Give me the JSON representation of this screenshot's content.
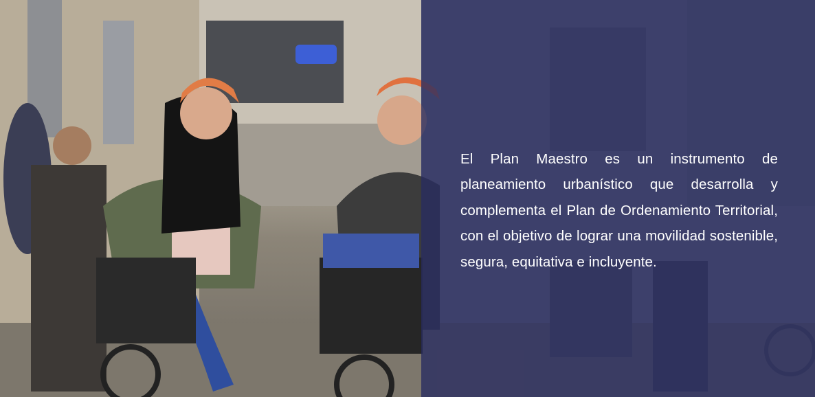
{
  "hero": {
    "image_alt": "Mujeres en bicicleta con cascos y canastas en una calle de la ciudad",
    "description": "El Plan Maestro es un instrumento de planeamiento urbanístico que desarrolla y complementa el Plan de Ordenamiento Territorial, con el objetivo de lograr una movilidad sostenible, segura, equitativa e incluyente.",
    "overlay_color": "#282c60"
  }
}
